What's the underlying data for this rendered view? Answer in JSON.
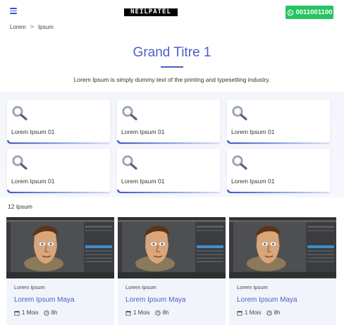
{
  "header": {
    "logo_text": "NEILPATEL",
    "phone": "0011001100",
    "menu_icon": "hamburger-icon",
    "phone_icon": "whatsapp-icon",
    "phone_button_color": "#25c55f"
  },
  "breadcrumb": {
    "items": [
      "Lorem",
      "Ipsum"
    ],
    "separator": ">"
  },
  "hero": {
    "title": "Grand Titre 1",
    "subtitle": "Lorem Ipsum is simply dummy text of the printing and typesetting industry."
  },
  "cards": [
    {
      "label": "Lorem Ipsum 01",
      "icon": "magnifier-icon"
    },
    {
      "label": "Lorem Ipsum 01",
      "icon": "magnifier-icon"
    },
    {
      "label": "Lorem Ipsum 01",
      "icon": "magnifier-icon"
    },
    {
      "label": "Lorem Ipsum 01",
      "icon": "magnifier-icon"
    },
    {
      "label": "Lorem Ipsum 01",
      "icon": "magnifier-icon"
    },
    {
      "label": "Lorem Ipsum 01",
      "icon": "magnifier-icon"
    }
  ],
  "results": {
    "count_text": "12 Ipsum"
  },
  "courses": [
    {
      "category": "Lorem Ipsum",
      "title": "Lorem Ipsum Maya",
      "duration": "1 Mois",
      "hours": "8h"
    },
    {
      "category": "Lorem Ipsum",
      "title": "Lorem Ipsum Maya",
      "duration": "1 Mois",
      "hours": "8h"
    },
    {
      "category": "Lorem Ipsum",
      "title": "Lorem Ipsum Maya",
      "duration": "1 Mois",
      "hours": "8h"
    }
  ],
  "colors": {
    "accent": "#4a5fc8",
    "whatsapp": "#25c55f",
    "card_bg": "#f2f4fb"
  }
}
